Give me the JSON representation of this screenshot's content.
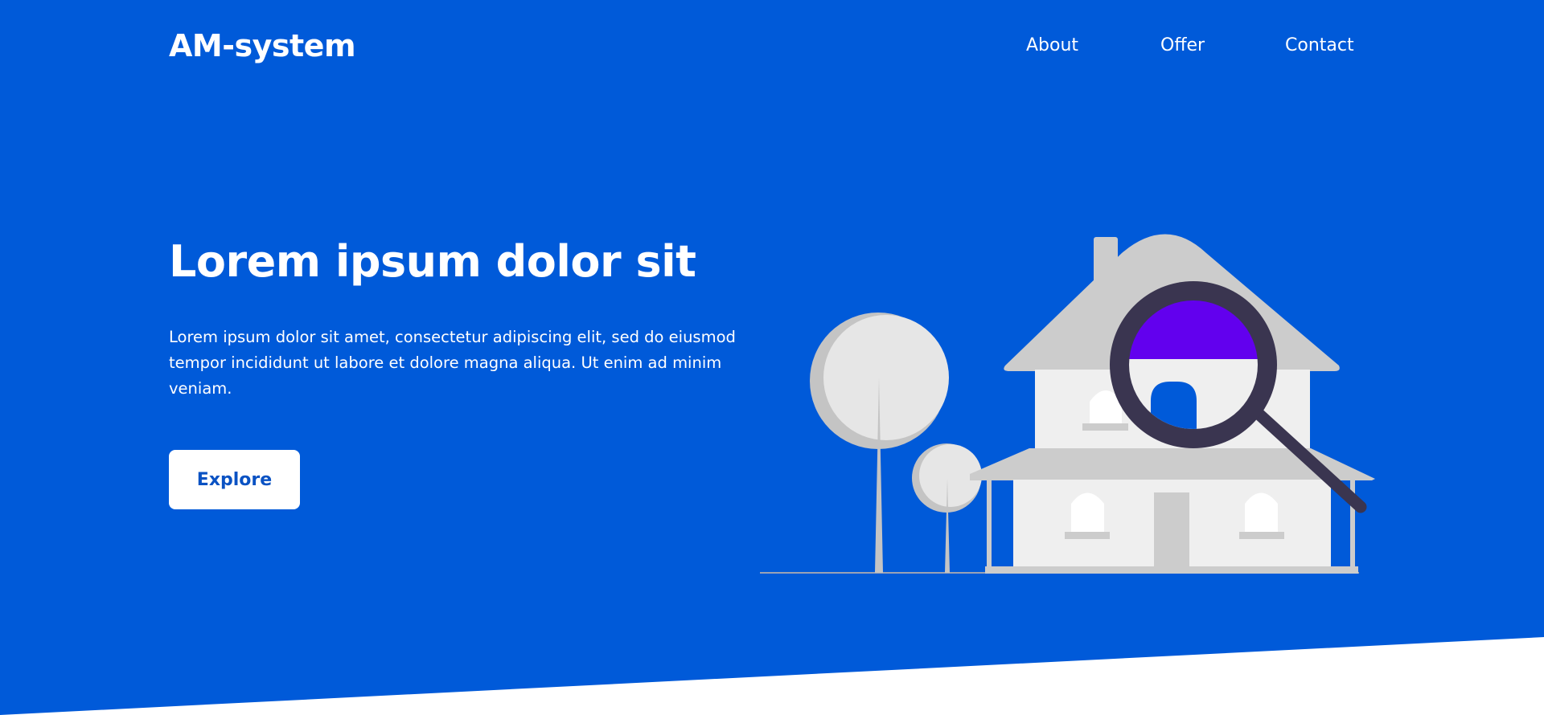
{
  "brand": {
    "name": "AM-system"
  },
  "nav": {
    "items": [
      {
        "label": "About"
      },
      {
        "label": "Offer"
      },
      {
        "label": "Contact"
      }
    ]
  },
  "hero": {
    "title": "Lorem ipsum dolor sit",
    "body": "Lorem ipsum dolor sit amet, consectetur adipiscing elit, sed do eiusmod tempor incididunt ut labore et dolore magna aliqua. Ut enim ad minim veniam.",
    "cta_label": "Explore",
    "illustration": "house-with-magnifying-glass"
  },
  "colors": {
    "background": "#005ad9",
    "accent": "#6200ee",
    "button_text": "#0a52c3",
    "surface": "#ffffff"
  }
}
